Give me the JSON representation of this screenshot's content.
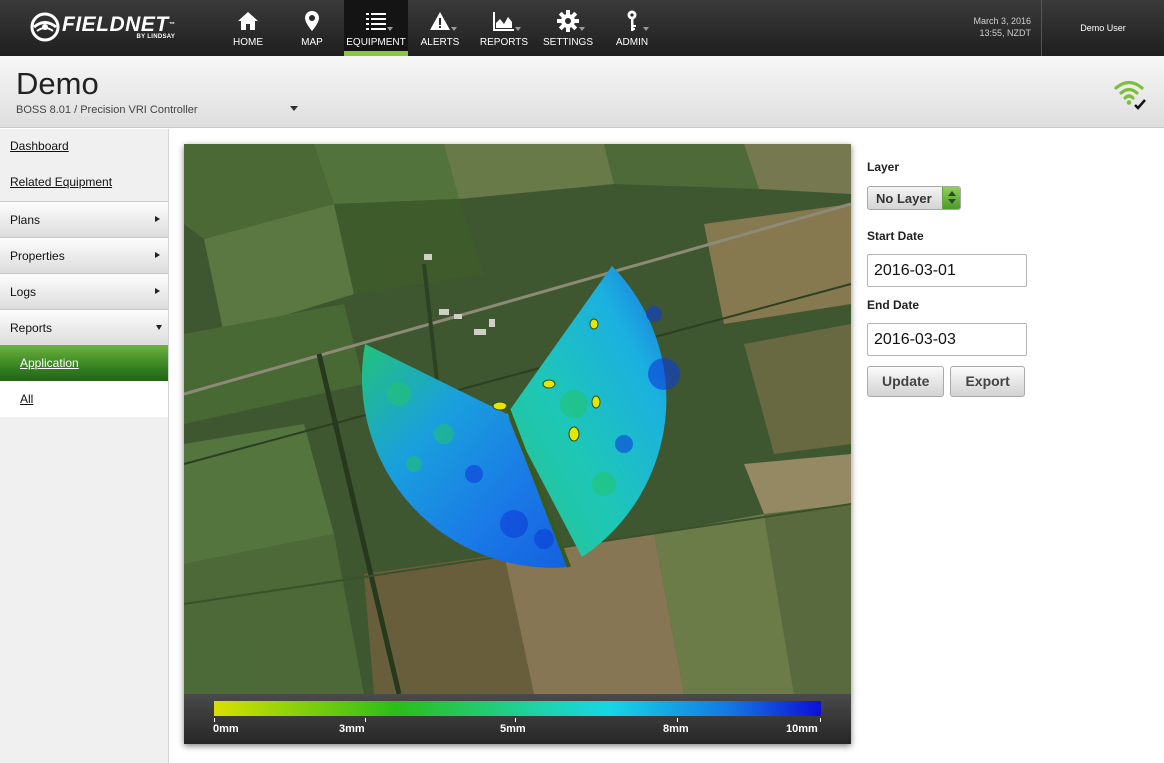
{
  "brand": {
    "name": "FIELDNET",
    "tm": "™",
    "sub": "BY LINDSAY"
  },
  "nav": [
    {
      "label": "HOME",
      "icon": "home-icon"
    },
    {
      "label": "MAP",
      "icon": "map-pin-icon"
    },
    {
      "label": "EQUIPMENT",
      "icon": "list-icon",
      "active": true
    },
    {
      "label": "ALERTS",
      "icon": "warning-icon"
    },
    {
      "label": "REPORTS",
      "icon": "chart-icon"
    },
    {
      "label": "SETTINGS",
      "icon": "gear-icon"
    },
    {
      "label": "ADMIN",
      "icon": "key-icon"
    }
  ],
  "datetime": {
    "date": "March 3, 2016",
    "time": "13:55, NZDT"
  },
  "user": "Demo User",
  "page": {
    "title": "Demo",
    "subtitle": "BOSS 8.01 / Precision VRI Controller"
  },
  "sidebar": {
    "links": [
      "Dashboard",
      "Related Equipment"
    ],
    "sections": [
      "Plans",
      "Properties",
      "Logs",
      "Reports"
    ],
    "reports_items": [
      "Application",
      "All"
    ]
  },
  "legend": {
    "labels": [
      "0mm",
      "3mm",
      "5mm",
      "8mm",
      "10mm"
    ]
  },
  "colors": {
    "accent": "#8cc63f",
    "legend_low": "#d8e000",
    "legend_high": "#0d0fd6"
  },
  "form": {
    "layer_label": "Layer",
    "layer_value": "No Layer",
    "start_label": "Start Date",
    "start_value": "2016-03-01",
    "end_label": "End Date",
    "end_value": "2016-03-03",
    "update_label": "Update",
    "export_label": "Export"
  }
}
